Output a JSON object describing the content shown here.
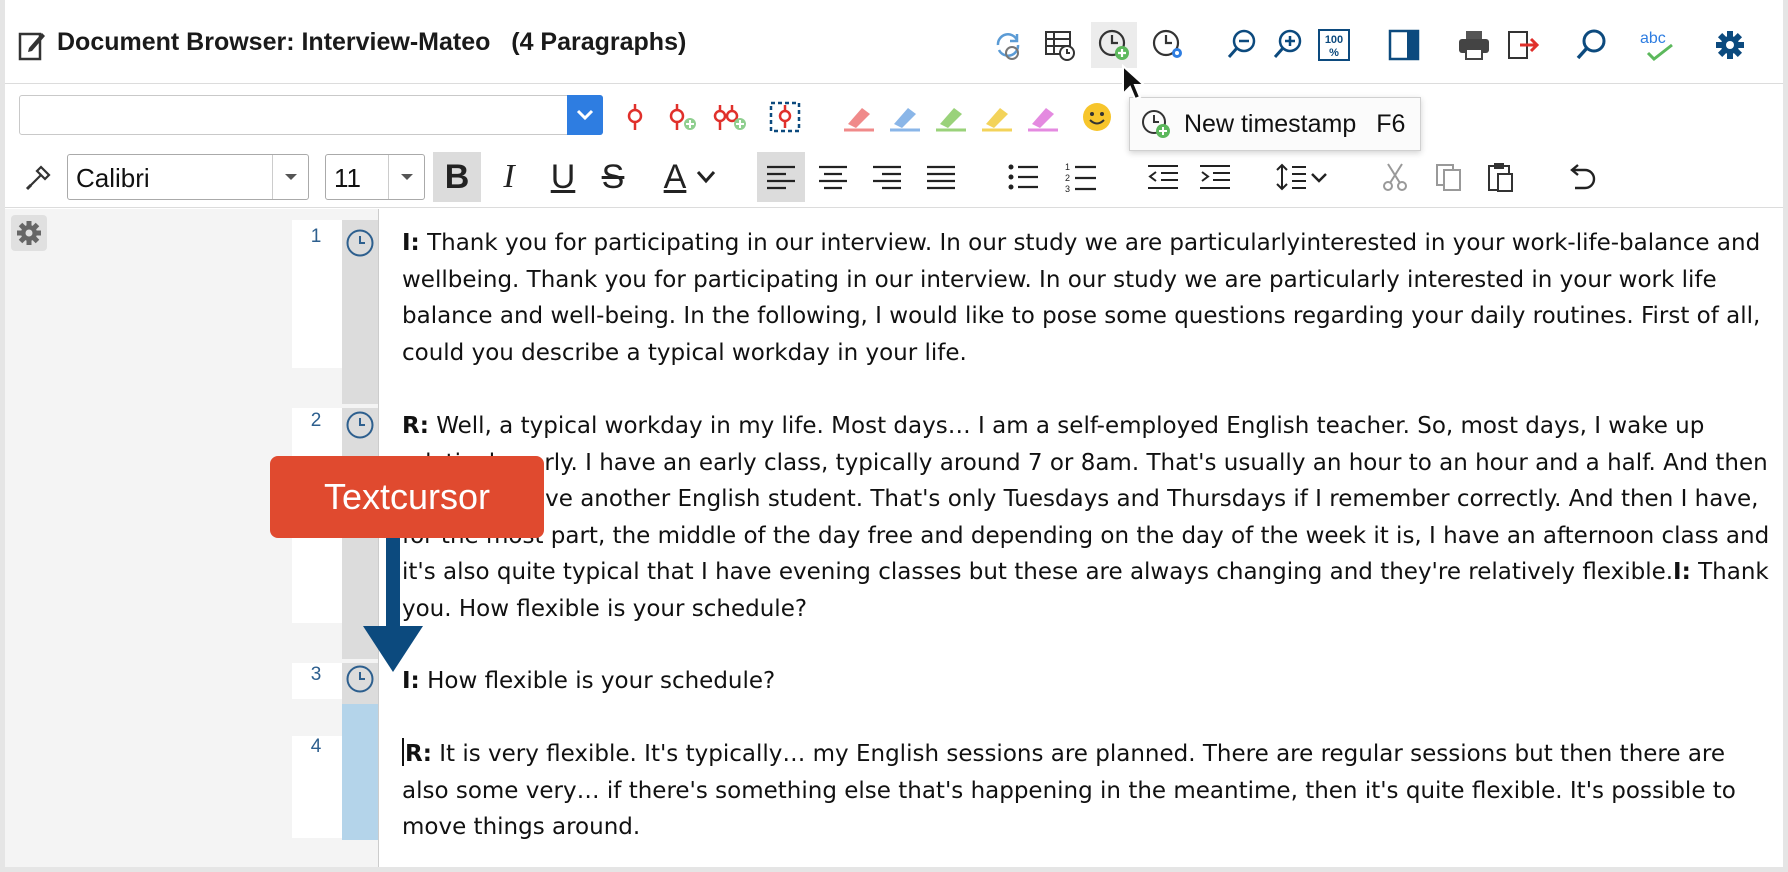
{
  "window": {
    "title": "Document Browser: Interview-Mateo   (4 Paragraphs)"
  },
  "title_toolbar": {
    "icons": [
      "refresh-icon",
      "table-clock-icon",
      "new-timestamp-icon",
      "timestamp-settings-icon",
      "zoom-out-icon",
      "zoom-in-icon",
      "zoom-100-icon",
      "side-panel-icon",
      "print-icon",
      "export-icon",
      "search-icon",
      "spellcheck-icon",
      "settings-icon"
    ],
    "spellcheck_label": "abc",
    "zoom_label": "100"
  },
  "code_toolbar": {
    "code_select_value": "",
    "icons": [
      "code-icon",
      "code-add-icon",
      "code-multi-add-icon",
      "code-frame-icon",
      "highlighter-red-icon",
      "highlighter-blue-icon",
      "highlighter-green-icon",
      "highlighter-yellow-icon",
      "highlighter-purple-icon",
      "emoticon-icon"
    ]
  },
  "tooltip": {
    "label": "New timestamp",
    "shortcut": "F6"
  },
  "format_toolbar": {
    "font": "Calibri",
    "size": "11",
    "bold": "B",
    "italic": "I",
    "underline": "U",
    "strike": "S",
    "font_color": "A"
  },
  "paragraphs": [
    {
      "num": "1",
      "speaker": "I:",
      "text": " Thank you for participating in our interview. In our study we are particularlyinterested in your work-life-balance and wellbeing. Thank you for participating in our interview. In our study we are particularly interested in your work life balance and well-being. In the following, I would like to pose some questions regarding your daily routines. First of all, could you describe a typical workday in your life."
    },
    {
      "num": "2",
      "speaker": "R:",
      "text": " Well, a typical workday in my life. Most days… I am a self-employed English teacher. So, most days, I wake up relatively early. I have an early class, typically around 7 or 8am. That's usually an hour to an hour and a half. And then perhaps I have another English student. That's only Tuesdays and Thursdays if I remember correctly. And then I have, for the most part, the middle of the day free and depending on the day of the week it is, I have an afternoon class and it's also quite typical that I have evening classes but these are always changing and they're relatively flexible.",
      "speaker2": "I:",
      "text2": " Thank you. How flexible is your schedule?"
    },
    {
      "num": "3",
      "speaker": "I:",
      "text": " How flexible is your schedule?"
    },
    {
      "num": "4",
      "speaker": "R:",
      "text": " It is very flexible. It's typically… my English sessions are planned. There are regular sessions but then there are also some very… if there's something else that's happening in the meantime, then it's quite flexible. It's possible to move things around."
    }
  ],
  "callout": {
    "label": "Textcursor"
  },
  "colors": {
    "accent_orange": "#f07c2c",
    "callout_red": "#e04a2f",
    "arrow_blue": "#0c4a7e",
    "select_blue": "#2e7de1",
    "selected_strip": "#b4d4ea"
  }
}
